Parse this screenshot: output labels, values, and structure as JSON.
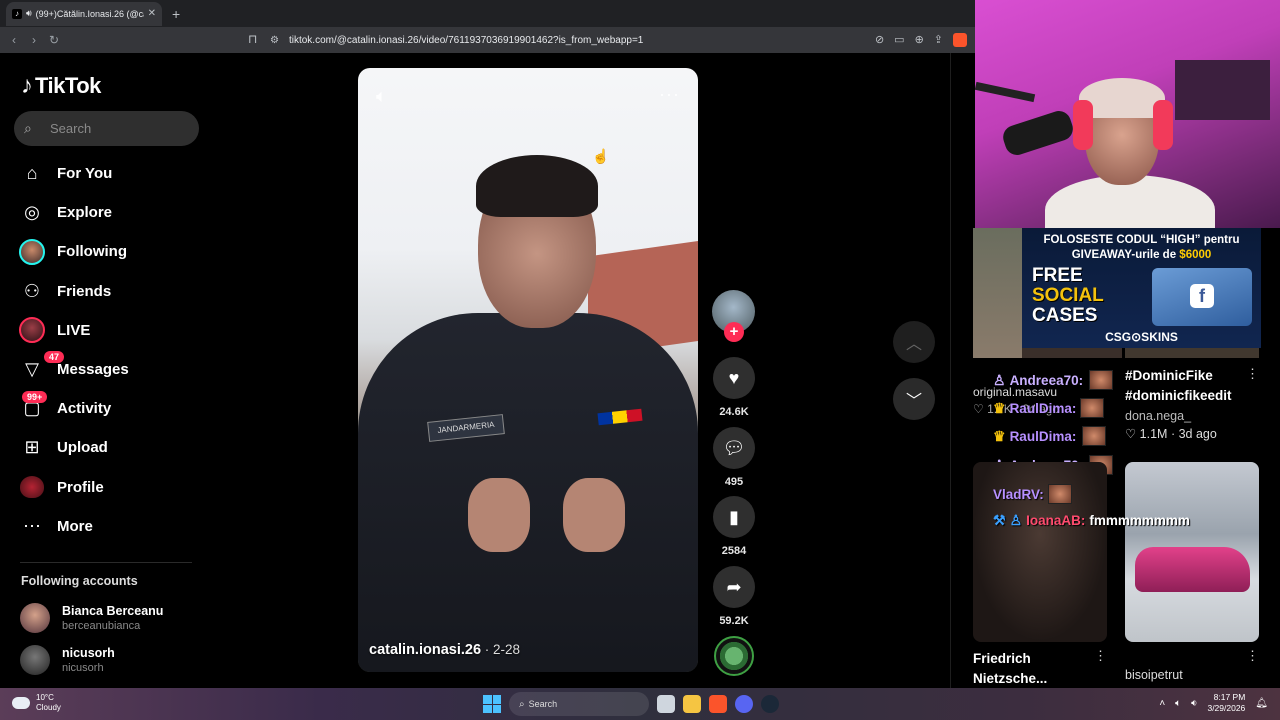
{
  "browser": {
    "tab_title": "(99+)Cătălin.Ionasi.26 (@cata",
    "url": "tiktok.com/@catalin.ionasi.26/video/7611937036919901462?is_from_webapp=1"
  },
  "sidebar": {
    "logo": "TikTok",
    "search_placeholder": "Search",
    "items": [
      {
        "label": "For You"
      },
      {
        "label": "Explore"
      },
      {
        "label": "Following"
      },
      {
        "label": "Friends"
      },
      {
        "label": "LIVE"
      },
      {
        "label": "Messages",
        "badge": "47"
      },
      {
        "label": "Activity",
        "badge": "99+"
      },
      {
        "label": "Upload"
      },
      {
        "label": "Profile"
      },
      {
        "label": "More"
      }
    ],
    "following_title": "Following accounts",
    "following": [
      {
        "name": "Bianca Berceanu",
        "handle": "berceanubianca"
      },
      {
        "name": "nicusorh",
        "handle": "nicusorh"
      }
    ]
  },
  "video": {
    "author": "catalin.ionasi.26",
    "date": " · 2-28",
    "patch_text": "JANDARMERIA"
  },
  "actions": {
    "likes": "24.6K",
    "comments": "495",
    "saves": "2584",
    "shares": "59.2K"
  },
  "stream": {
    "promo_line1": "FOLOSESTE CODUL “HIGH” pentru",
    "promo_line2_prefix": "GIVEAWAY-urile de ",
    "promo_amount": "$6000",
    "promo_big1": "FREE",
    "promo_big2": "SOCIAL",
    "promo_big3": "CASES",
    "promo_brand": "CSG⊙SKINS",
    "chat": [
      {
        "user": "Andreea70:"
      },
      {
        "user": "RaulDima:"
      },
      {
        "user": "RaulDima:"
      },
      {
        "user": "Andreea70:"
      },
      {
        "user": "VladRV:"
      },
      {
        "user": "IoanaAB:",
        "msg": "fmmmmmmmm"
      }
    ]
  },
  "feed": {
    "right1_title1": "#DominicFike",
    "right1_title2": "#dominicfikeedit",
    "right1_author": "dona.nega_",
    "right1_stats": "♡ 1.1M · 3d ago",
    "left1_author": "original.masavu",
    "left1_stats": "♡ 1.2K · 2d ago",
    "left2_title1": "Friedrich",
    "left2_title2": "Nietzsche...",
    "right2_author": "bisoipetrut"
  },
  "taskbar": {
    "temp": "10°C",
    "weather": "Cloudy",
    "search": "Search",
    "time": "8:17 PM",
    "date": "3/29/2026"
  }
}
